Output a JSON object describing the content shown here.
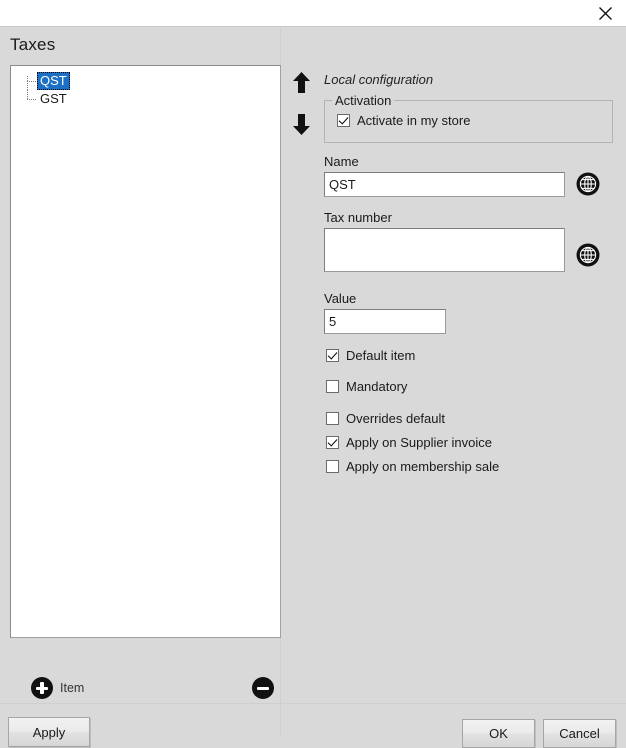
{
  "window": {
    "close_icon": "close-icon",
    "title": "Taxes"
  },
  "left_panel": {
    "tree_items": [
      {
        "label": "QST",
        "selected": true
      },
      {
        "label": "GST",
        "selected": false
      }
    ],
    "add_item_label": "Item",
    "add_icon": "plus-circle-icon",
    "remove_icon": "minus-circle-icon"
  },
  "reorder": {
    "up_icon": "arrow-up-icon",
    "down_icon": "arrow-down-icon"
  },
  "right_panel": {
    "section_title": "Local configuration",
    "activation": {
      "legend": "Activation",
      "checkbox_label": "Activate in my store",
      "checked": true
    },
    "name": {
      "label": "Name",
      "value": "QST",
      "placeholder": "",
      "globe_icon": "globe-icon"
    },
    "tax_number": {
      "label": "Tax number",
      "value": "",
      "placeholder": "",
      "globe_icon": "globe-icon"
    },
    "value_field": {
      "label": "Value",
      "value": "5",
      "placeholder": ""
    },
    "options": [
      {
        "label": "Default item",
        "checked": true
      },
      {
        "label": "Mandatory",
        "checked": false
      },
      {
        "label": "Overrides default",
        "checked": false
      },
      {
        "label": "Apply on Supplier invoice",
        "checked": true
      },
      {
        "label": "Apply on membership sale",
        "checked": false
      }
    ]
  },
  "buttons": {
    "apply": "Apply",
    "ok": "OK",
    "cancel": "Cancel"
  },
  "colors": {
    "window_bg": "#d9d9d9",
    "titlebar_bg": "#ffffff",
    "selection_blue": "#1b6fc4",
    "field_bg": "#ffffff"
  }
}
